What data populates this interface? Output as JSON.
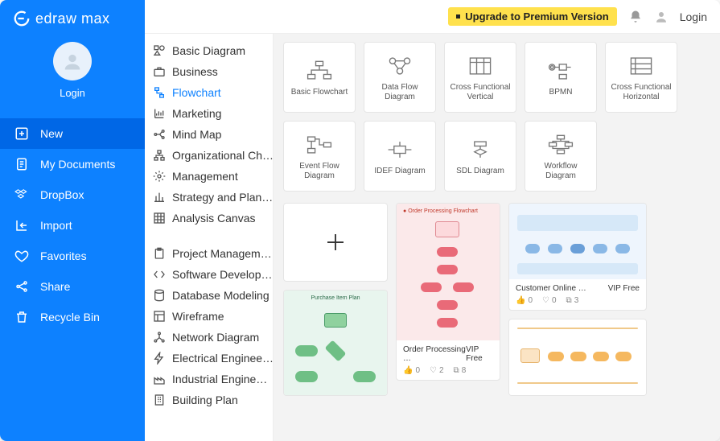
{
  "brand": {
    "name": "edraw max"
  },
  "topbar": {
    "upgrade": "Upgrade to Premium Version",
    "login": "Login"
  },
  "sidebar": {
    "avatar_label": "Login",
    "items": [
      {
        "label": "New",
        "icon": "plus-square"
      },
      {
        "label": "My Documents",
        "icon": "doc-list"
      },
      {
        "label": "DropBox",
        "icon": "dropbox"
      },
      {
        "label": "Import",
        "icon": "import"
      },
      {
        "label": "Favorites",
        "icon": "heart"
      },
      {
        "label": "Share",
        "icon": "share"
      },
      {
        "label": "Recycle Bin",
        "icon": "trash"
      }
    ]
  },
  "categories_top": [
    "Basic Diagram",
    "Business",
    "Flowchart",
    "Marketing",
    "Mind Map",
    "Organizational Ch…",
    "Management",
    "Strategy and Plan…",
    "Analysis Canvas"
  ],
  "categories_bottom": [
    "Project Managem…",
    "Software Develop…",
    "Database Modeling",
    "Wireframe",
    "Network Diagram",
    "Electrical Enginee…",
    "Industrial Engine…",
    "Building Plan"
  ],
  "tiles": [
    "Basic Flowchart",
    "Data Flow Diagram",
    "Cross Functional Vertical",
    "BPMN",
    "Cross Functional Horizontal",
    "Event Flow Diagram",
    "IDEF Diagram",
    "SDL Diagram",
    "Workflow Diagram"
  ],
  "templates": {
    "order": {
      "title": "Order Processing …",
      "tag": "VIP Free",
      "likes": "0",
      "favs": "2",
      "copies": "8",
      "banner": "Order Processing Flowchart"
    },
    "customer": {
      "title": "Customer Online …",
      "tag": "VIP Free",
      "likes": "0",
      "favs": "0",
      "copies": "3"
    },
    "purchase": {
      "banner": "Purchase Item Plan"
    }
  }
}
